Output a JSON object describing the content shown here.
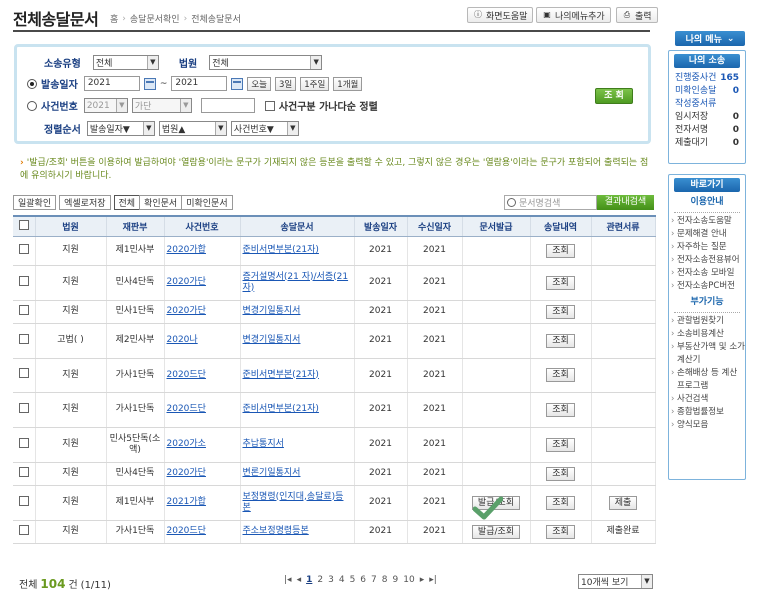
{
  "header": {
    "title": "전체송달문서",
    "breadcrumb": [
      "홈",
      "송달문서확인",
      "전체송달문서"
    ],
    "buttons": {
      "help": "화면도움말",
      "add_menu": "나의메뉴추가",
      "print": "출력"
    }
  },
  "search": {
    "type_label": "소송유형",
    "type_value": "전체",
    "court_label": "법원",
    "court_value": "전체",
    "date_label": "발송일자",
    "date_from": "2021",
    "date_tilde": "~",
    "date_to": "2021",
    "quick": [
      "오늘",
      "3일",
      "1주일",
      "1개월"
    ],
    "case_label": "사건번호",
    "case_year": "2021",
    "case_kind": "가단",
    "multi_label": "사건구분 가나다순 정렬",
    "order_label": "정렬순서",
    "order": [
      "발송일자▼",
      "법원▲",
      "사건번호▼"
    ],
    "submit": "조 회"
  },
  "notice": "'발급/조회' 버튼을 이용하여 발급하여야 '열람용'이라는 문구가 기재되지 않은 등본을 출력할 수 있고, 그렇지 않은 경우는 '열람용'이라는 문구가 포함되어 출력되는 점에 유의하시기 바랍니다.",
  "toolbar": {
    "bulk": "일괄확인",
    "excel": "엑셀로저장",
    "seg": [
      "전체",
      "확인문서",
      "미확인문서"
    ],
    "search_placeholder": "문서명검색",
    "search_btn": "결과내검색"
  },
  "table": {
    "headers": [
      "법원",
      "재판부",
      "사건번호",
      "송달문서",
      "발송일자",
      "수신일자",
      "문서발급",
      "송달내역",
      "관련서류"
    ],
    "rows": [
      {
        "court": "지원",
        "dept": "제1민사부",
        "case": "2020가합",
        "doc": "준비서면부본(21자)",
        "sent": "2021",
        "recv": "2021",
        "issue": "",
        "hist": "조회",
        "rel": ""
      },
      {
        "court": "지원",
        "dept": "민사4단독",
        "case": "2020가단",
        "doc": "증거설명서(21 자)/서증(21 자)",
        "sent": "2021",
        "recv": "2021",
        "issue": "",
        "hist": "조회",
        "rel": ""
      },
      {
        "court": "지원",
        "dept": "민사1단독",
        "case": "2020가단",
        "doc": "변경기일통지서",
        "sent": "2021",
        "recv": "2021",
        "issue": "",
        "hist": "조회",
        "rel": ""
      },
      {
        "court": "고법( )",
        "dept": "제2민사부",
        "case": "2020나",
        "doc": "변경기일통지서",
        "sent": "2021",
        "recv": "2021",
        "issue": "",
        "hist": "조회",
        "rel": ""
      },
      {
        "court": "지원",
        "dept": "가사1단독",
        "case": "2020드단",
        "doc": "준비서면부본(21자)",
        "sent": "2021",
        "recv": "2021",
        "issue": "",
        "hist": "조회",
        "rel": ""
      },
      {
        "court": "지원",
        "dept": "가사1단독",
        "case": "2020드단",
        "doc": "준비서면부본(21자)",
        "sent": "2021",
        "recv": "2021",
        "issue": "",
        "hist": "조회",
        "rel": ""
      },
      {
        "court": "지원",
        "dept": "민사5단독(소액)",
        "case": "2020가소",
        "doc": "추납통지서",
        "sent": "2021",
        "recv": "2021",
        "issue": "",
        "hist": "조회",
        "rel": ""
      },
      {
        "court": "지원",
        "dept": "민사4단독",
        "case": "2020가단",
        "doc": "변론기일통지서",
        "sent": "2021",
        "recv": "2021",
        "issue": "",
        "hist": "조회",
        "rel": ""
      },
      {
        "court": "지원",
        "dept": "제1민사부",
        "case": "2021가합",
        "doc": "보정명령(인지대,송달료)등본",
        "sent": "2021",
        "recv": "2021",
        "issue": "발급/조회",
        "hist": "조회",
        "rel": "제출"
      },
      {
        "court": "지원",
        "dept": "가사1단독",
        "case": "2020드단",
        "doc": "주소보정명령등본",
        "sent": "2021",
        "recv": "2021",
        "issue": "발급/조회",
        "hist": "조회",
        "rel": "제출완료"
      }
    ]
  },
  "footer": {
    "total_prefix": "전체",
    "total": "104",
    "total_suffix": "건",
    "pages": "(1/11)",
    "page_nums": [
      "1",
      "2",
      "3",
      "4",
      "5",
      "6",
      "7",
      "8",
      "9",
      "10"
    ],
    "per_page": "10개씩 보기"
  },
  "sidebar": {
    "my_menu": "나의 메뉴",
    "my_suit": "나의 소송",
    "stats": [
      {
        "label": "진행중사건",
        "value": "165"
      },
      {
        "label": "미확인송달",
        "value": "0"
      }
    ],
    "draft": "작성중서류",
    "drafts": [
      {
        "label": "임시저장",
        "value": "0"
      },
      {
        "label": "전자서명",
        "value": "0"
      },
      {
        "label": "제출대기",
        "value": "0"
      }
    ],
    "shortcut": "바로가기",
    "guide": "이용안내",
    "guide_links": [
      "전자소송도움말",
      "문제해결 안내",
      "자주하는 질문",
      "전자소송전용뷰어",
      "전자소송 모바일",
      "전자소송PC버전"
    ],
    "extra": "부가기능",
    "extra_links": [
      "관할법원찾기",
      "소송비용계산",
      "부동산가액 및 소가계산기",
      "손해배상 등 계산 프로그램",
      "사건검색",
      "종합법률정보",
      "양식모음"
    ]
  },
  "colors": {
    "accent": "#1b66ad",
    "green": "#4e9b22",
    "notice": "#6a8a1f"
  }
}
